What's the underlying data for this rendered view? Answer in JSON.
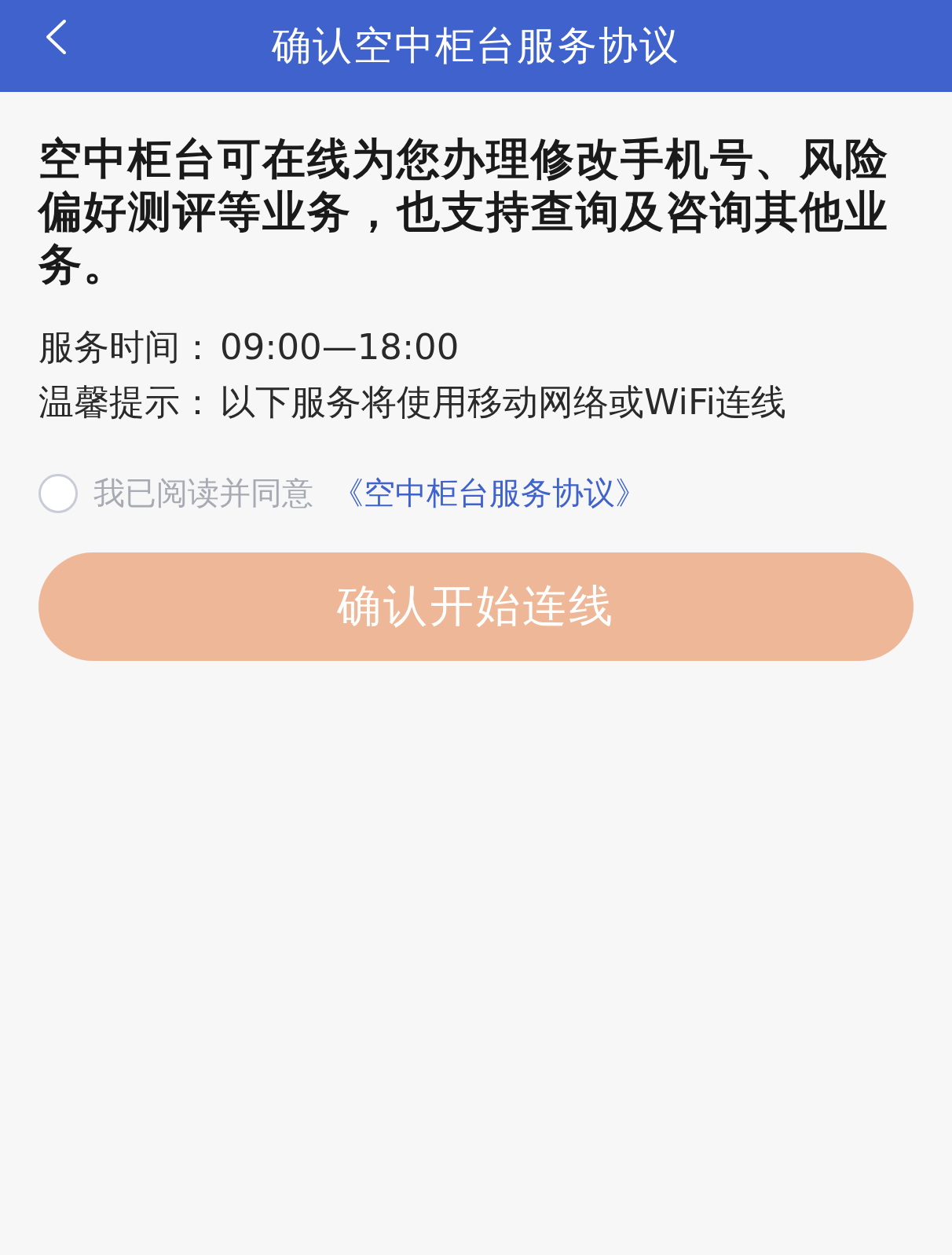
{
  "header": {
    "title": "确认空中柜台服务协议"
  },
  "intro": "空中柜台可在线为您办理修改手机号、风险偏好测评等业务，也支持查询及咨询其他业务。",
  "info": [
    {
      "label": "服务时间：",
      "value": "09:00—18:00"
    },
    {
      "label": "温馨提示：",
      "value": "以下服务将使用移动网络或WiFi连线"
    }
  ],
  "agreement": {
    "checked": false,
    "text": "我已阅读并同意",
    "link": "《空中柜台服务协议》"
  },
  "confirm_button": {
    "label": "确认开始连线",
    "disabled": true
  }
}
